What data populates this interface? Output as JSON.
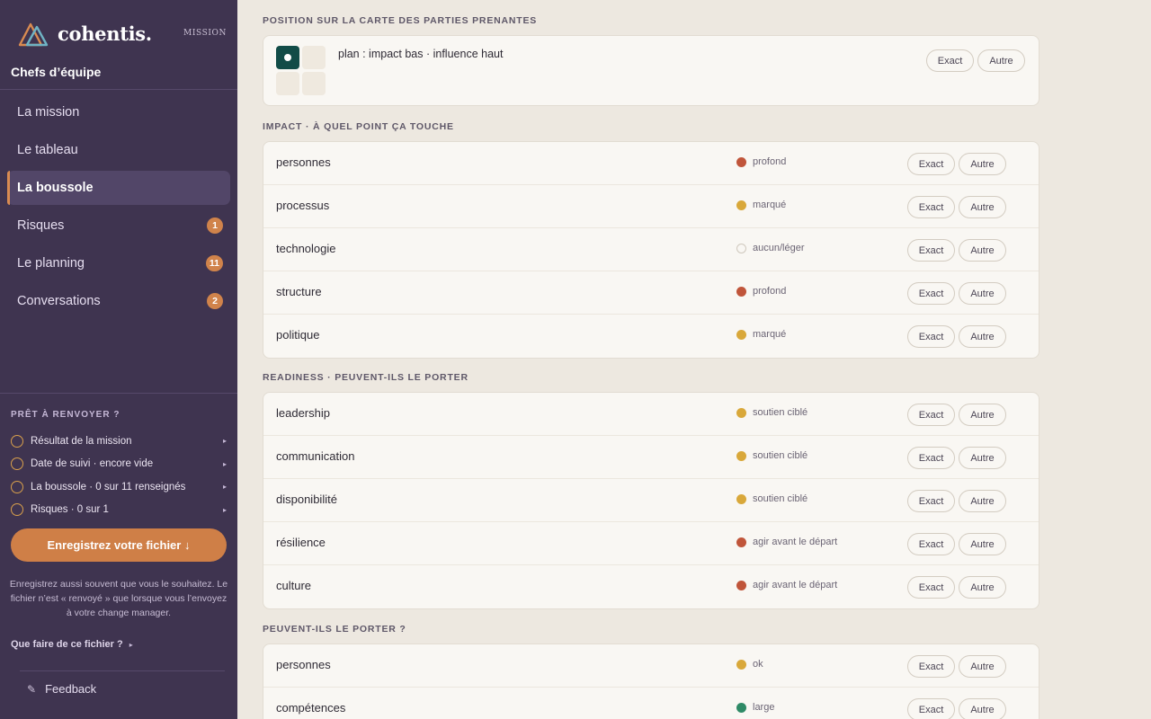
{
  "sidebar": {
    "brand": "cohentis.",
    "tag": "MISSION",
    "team": "Chefs d’équipe",
    "nav": [
      {
        "label": "La mission",
        "badge": ""
      },
      {
        "label": "Le tableau",
        "badge": ""
      },
      {
        "label": "La boussole",
        "badge": ""
      },
      {
        "label": "Risques",
        "badge": "1"
      },
      {
        "label": "Le planning",
        "badge": "11"
      },
      {
        "label": "Conversations",
        "badge": "2"
      }
    ],
    "active_index": 2,
    "checklist_title": "PRÊT À RENVOYER ?",
    "checklist": [
      "Résultat de la mission",
      "Date de suivi · encore vide",
      "La boussole · 0 sur 11 renseignés",
      "Risques · 0 sur 1"
    ],
    "save_button": "Enregistrez votre fichier ↓",
    "save_note": "Enregistrez aussi souvent que vous le souhaitez. Le fichier n’est « renvoyé » que lorsque vous l’envoyez à votre change manager.",
    "help_link": "Que faire de ce fichier ?",
    "help_arrow": "▸",
    "feedback": "Feedback",
    "feedback_icon": "✎"
  },
  "buttons": {
    "exact": "Exact",
    "other": "Autre"
  },
  "sections": {
    "map": {
      "title": "POSITION SUR LA CARTE DES PARTIES PRENANTES",
      "text": "plan : impact bas · influence haut",
      "grid_selected": "top-left"
    },
    "impact": {
      "title": "IMPACT · À QUEL POINT ÇA TOUCHE",
      "rows": [
        {
          "label": "personnes",
          "status": "profond",
          "color": "#c0553a"
        },
        {
          "label": "processus",
          "status": "marqué",
          "color": "#d9a83a"
        },
        {
          "label": "technologie",
          "status": "aucun/léger",
          "color": ""
        },
        {
          "label": "structure",
          "status": "profond",
          "color": "#c0553a"
        },
        {
          "label": "politique",
          "status": "marqué",
          "color": "#d9a83a"
        }
      ]
    },
    "readiness": {
      "title": "READINESS · PEUVENT-ILS LE PORTER",
      "rows": [
        {
          "label": "leadership",
          "status": "soutien ciblé",
          "color": "#d9a83a"
        },
        {
          "label": "communication",
          "status": "soutien ciblé",
          "color": "#d9a83a"
        },
        {
          "label": "disponibilité",
          "status": "soutien ciblé",
          "color": "#d9a83a"
        },
        {
          "label": "résilience",
          "status": "agir avant le départ",
          "color": "#c0553a"
        },
        {
          "label": "culture",
          "status": "agir avant le départ",
          "color": "#c0553a"
        }
      ]
    },
    "capacity": {
      "title": "PEUVENT-ILS LE PORTER ?",
      "rows": [
        {
          "label": "personnes",
          "status": "ok",
          "color": "#d9a83a"
        },
        {
          "label": "compétences",
          "status": "large",
          "color": "#2f8a66"
        }
      ]
    }
  }
}
